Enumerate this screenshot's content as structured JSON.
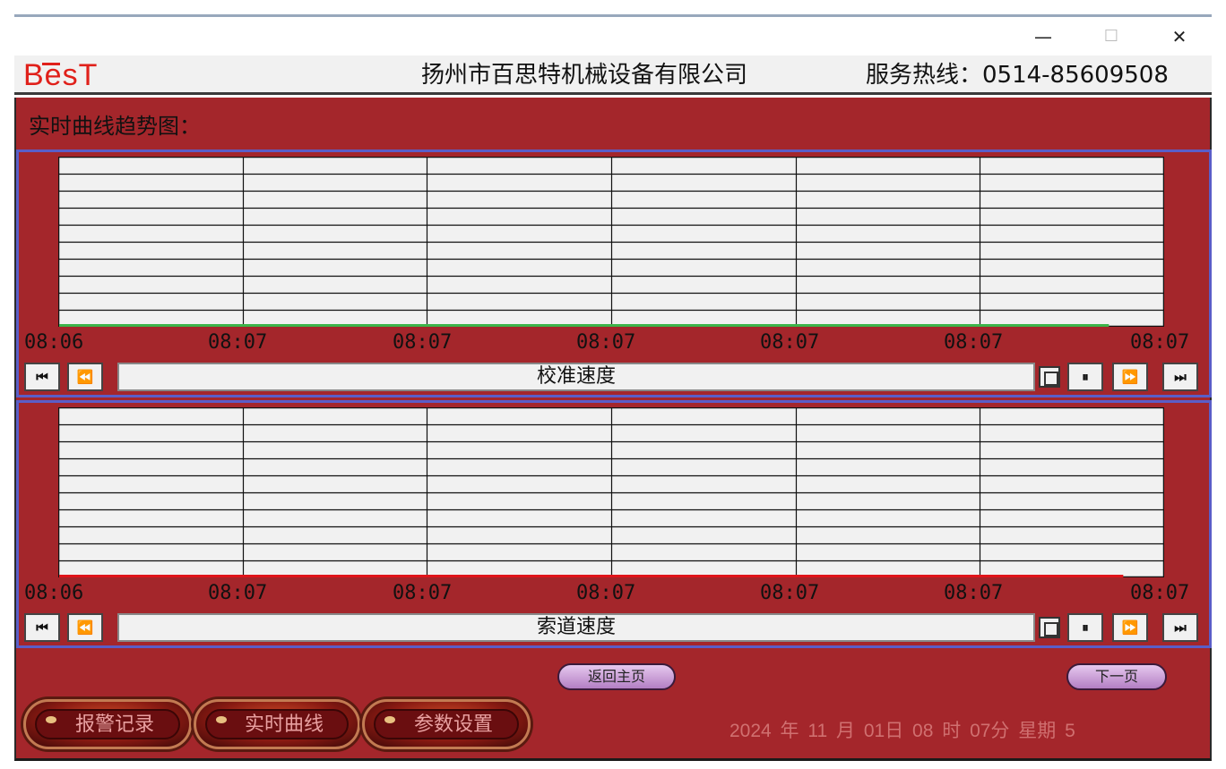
{
  "window": {
    "minimize_symbol": "—",
    "maximize_symbol": "☐",
    "close_symbol": "✕"
  },
  "header": {
    "logo": "BesT",
    "company": "扬州市百思特机械设备有限公司",
    "hotline": "服务热线：0514-85609508"
  },
  "page_title": "实时曲线趋势图：",
  "trends": [
    {
      "label": "校准速度",
      "ticks": [
        "08:06",
        "08:07",
        "08:07",
        "08:07",
        "08:07",
        "08:07",
        "08:07"
      ],
      "line_color": "#3cb44a",
      "line_level": 0.0,
      "line_extent": 0.95
    },
    {
      "label": "索道速度",
      "ticks": [
        "08:06",
        "08:07",
        "08:07",
        "08:07",
        "08:07",
        "08:07",
        "08:07"
      ],
      "line_color": "#e0141a",
      "line_level": 0.0,
      "line_extent": 0.963
    }
  ],
  "toolbar_icons": {
    "first": "⏮",
    "rewind": "⏪",
    "grid": "grid-icon",
    "pause": "⏸",
    "forward": "⏩",
    "last": "⏭"
  },
  "nav": {
    "back": "返回主页",
    "next": "下一页"
  },
  "menu": {
    "alarm": "报警记录",
    "trend": "实时曲线",
    "param": "参数设置"
  },
  "datetime": "2024 年 11 月 01日 08 时 07分 星期 5",
  "colors": {
    "panel_bg": "#a4262b",
    "trend_border": "#5a5ec8",
    "datetime_text": "#d07070"
  }
}
